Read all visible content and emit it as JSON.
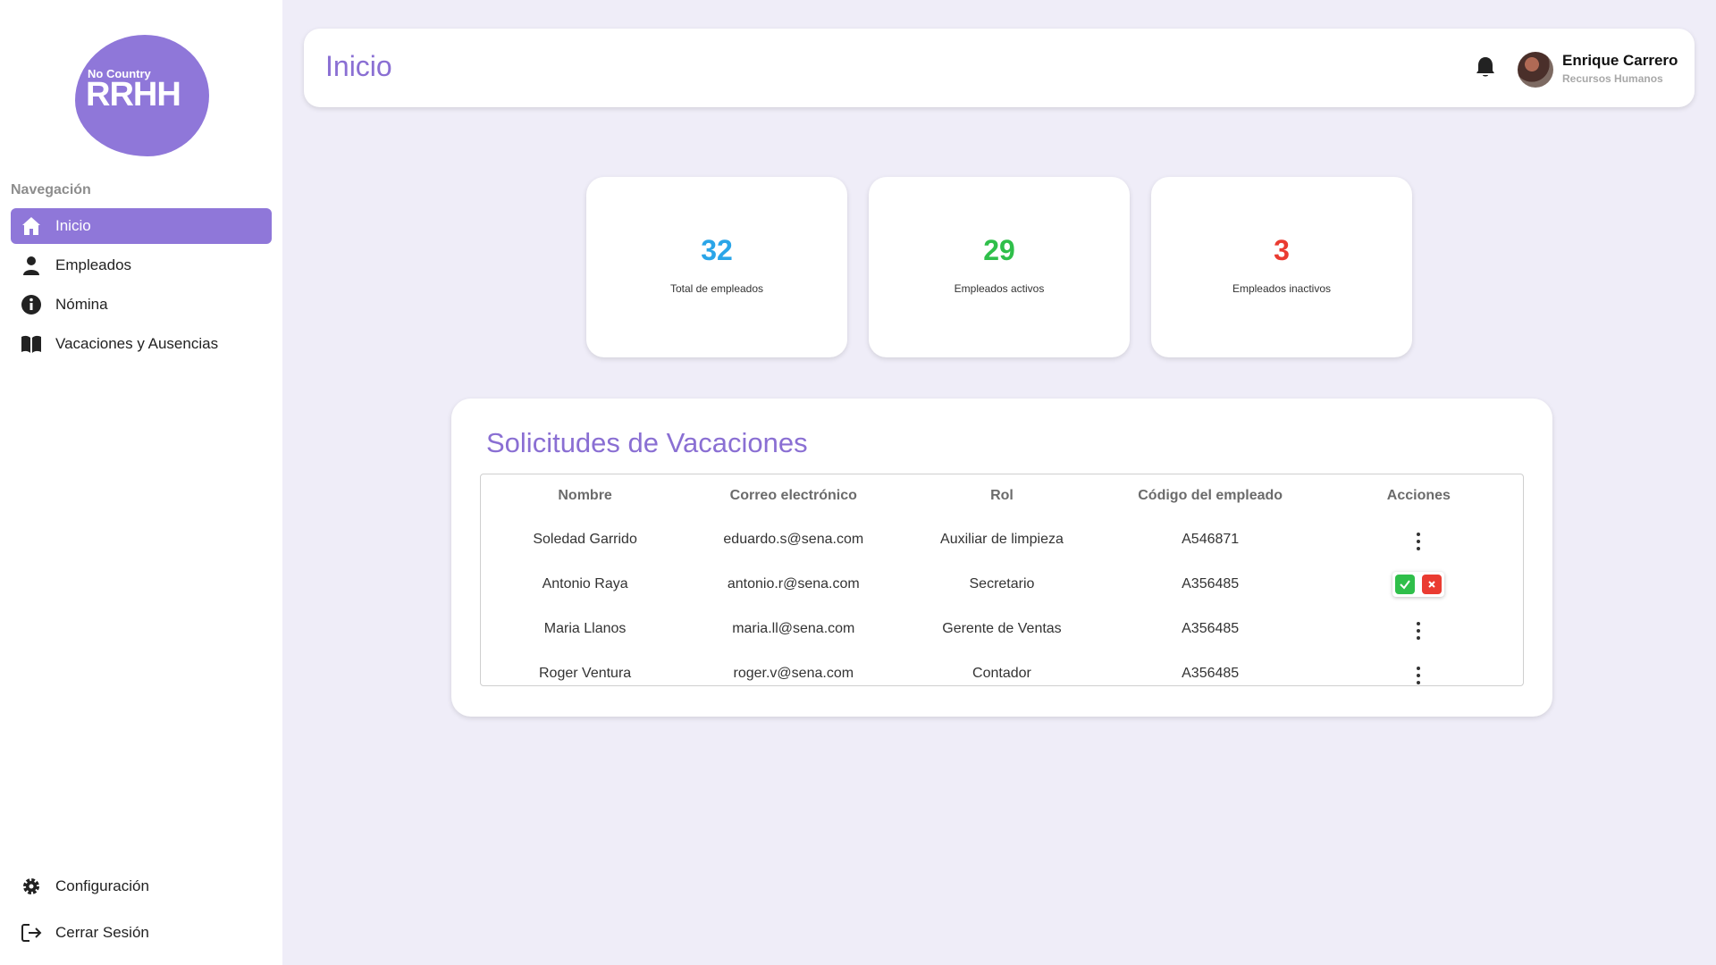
{
  "brand": {
    "line1": "No Country",
    "line2": "RRHH",
    "color": "#8f77d9"
  },
  "nav": {
    "heading": "Navegación",
    "items": [
      {
        "label": "Inicio",
        "icon": "home-icon",
        "active": true
      },
      {
        "label": "Empleados",
        "icon": "user-icon"
      },
      {
        "label": "Nómina",
        "icon": "info-icon"
      },
      {
        "label": "Vacaciones y Ausencias",
        "icon": "book-icon"
      }
    ],
    "bottom": [
      {
        "label": "Configuración",
        "icon": "gear-icon"
      },
      {
        "label": "Cerrar Sesión",
        "icon": "logout-icon"
      }
    ]
  },
  "header": {
    "title": "Inicio",
    "user_name": "Enrique Carrero",
    "user_role": "Recursos Humanos"
  },
  "stats": [
    {
      "value": "32",
      "label": "Total de empleados",
      "color": "#2aa5e8"
    },
    {
      "value": "29",
      "label": "Empleados activos",
      "color": "#2fbf4a"
    },
    {
      "value": "3",
      "label": "Empleados inactivos",
      "color": "#ea3b31"
    }
  ],
  "requests": {
    "title": "Solicitudes de Vacaciones",
    "columns": [
      "Nombre",
      "Correo electrónico",
      "Rol",
      "Código del empleado",
      "Acciones"
    ],
    "rows": [
      {
        "name": "Soledad Garrido",
        "email": "eduardo.s@sena.com",
        "role": "Auxiliar de limpieza",
        "code": "A546871",
        "actions": "menu"
      },
      {
        "name": "Antonio Raya",
        "email": "antonio.r@sena.com",
        "role": "Secretario",
        "code": "A356485",
        "actions": "approve-reject"
      },
      {
        "name": "Maria Llanos",
        "email": "maria.ll@sena.com",
        "role": "Gerente de Ventas",
        "code": "A356485",
        "actions": "menu"
      },
      {
        "name": "Roger Ventura",
        "email": "roger.v@sena.com",
        "role": "Contador",
        "code": "A356485",
        "actions": "menu"
      }
    ]
  },
  "colors": {
    "accent": "#8a6fd3",
    "approve": "#2fbf4a",
    "reject": "#ea3b31",
    "background": "#efedf8"
  }
}
